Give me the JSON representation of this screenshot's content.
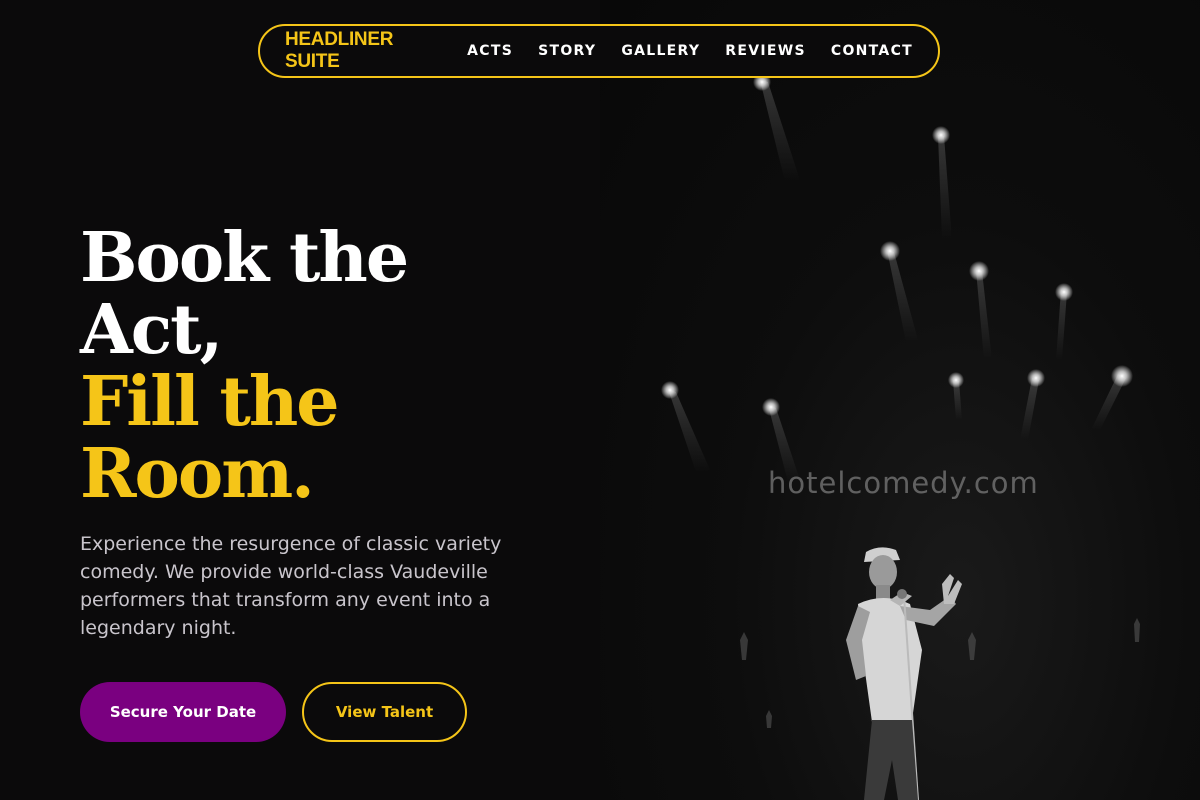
{
  "nav": {
    "brand": "HEADLINER SUITE",
    "links": [
      "ACTS",
      "STORY",
      "GALLERY",
      "REVIEWS",
      "CONTACT"
    ]
  },
  "hero": {
    "headline_line1": "Book the",
    "headline_line2": "Act,",
    "headline_line3": "Fill the",
    "headline_line4": "Room.",
    "lead": "Experience the resurgence of classic variety comedy. We provide world-class Vaudeville performers that transform any event into a legendary night.",
    "primary_cta": "Secure Your Date",
    "secondary_cta": "View Talent",
    "photo_watermark": "hotelcomedy.com"
  },
  "colors": {
    "background": "#0b0a0b",
    "accent_yellow": "#f5c518",
    "primary_button": "#7a0080",
    "text_muted": "#c9c5cc"
  }
}
